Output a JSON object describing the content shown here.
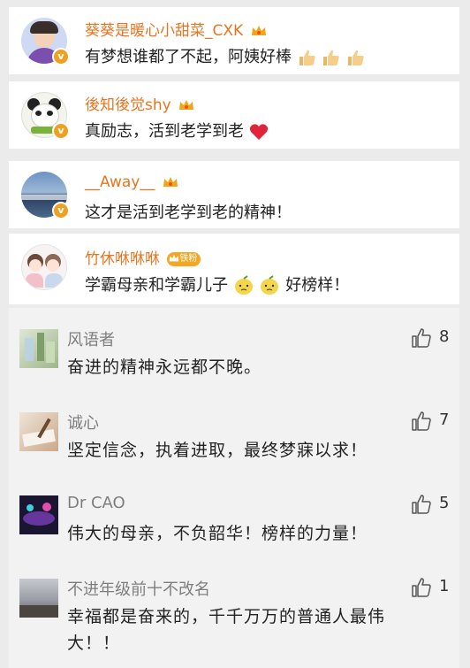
{
  "top_comments": [
    {
      "name": "葵葵是暖心小甜菜_CXK",
      "text": "有梦想谁都了不起，阿姨好棒",
      "verified": "v"
    },
    {
      "name": "後知後觉shy",
      "text": "真励志，活到老学到老",
      "verified": "v"
    },
    {
      "name": "__Away__",
      "text": "这才是活到老学到老的精神！",
      "verified": "v"
    },
    {
      "name": "竹休咻咻咻",
      "fan_badge": "铁粉",
      "text_a": "学霸母亲和学霸儿子",
      "text_b": "好榜样！"
    }
  ],
  "replies": [
    {
      "name": "风语者",
      "likes": "8",
      "lines": [
        "奋进的精神永远都不晚。"
      ]
    },
    {
      "name": "诚心",
      "likes": "7",
      "lines": [
        "坚定信念，执着进取，最终梦寐以求！"
      ]
    },
    {
      "name": "Dr CAO",
      "likes": "5",
      "lines": [
        "伟大的母亲，不负韶华！榜样的力量！"
      ]
    },
    {
      "name": "不进年级前十不改名",
      "likes": "1",
      "lines": [
        "幸福都是奋来的，千千万万的普通人最伟",
        "大！！"
      ]
    }
  ],
  "colors": {
    "username": "#e8741f",
    "badge": "#f0a020",
    "background": "#ebebeb"
  }
}
